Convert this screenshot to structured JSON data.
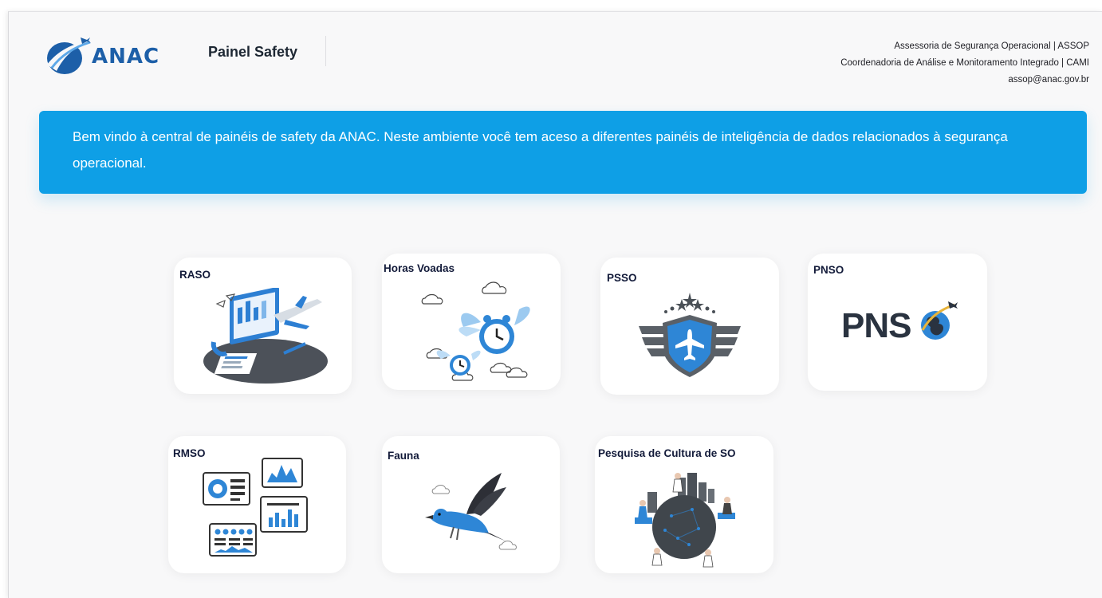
{
  "header": {
    "logo_text": "ANAC",
    "panel_title": "Painel Safety",
    "contact": {
      "line1": "Assessoria de Segurança Operacional | ASSOP",
      "line2": "Coordenadoria de Análise e Monitoramento Integrado | CAMI",
      "email": "assop@anac.gov.br"
    }
  },
  "banner": {
    "text": "Bem vindo à central de painéis de safety da ANAC. Neste ambiente você tem aceso a diferentes painéis de inteligência de dados relacionados à segurança operacional."
  },
  "cards": [
    {
      "title": "RASO"
    },
    {
      "title": "Horas Voadas"
    },
    {
      "title": "PSSO"
    },
    {
      "title": "PNSO",
      "logo_text": "PNS"
    },
    {
      "title": "RMSO"
    },
    {
      "title": "Fauna"
    },
    {
      "title": "Pesquisa de Cultura de SO"
    }
  ],
  "colors": {
    "brand_blue": "#1d5fa8",
    "banner_blue": "#0e9fe6",
    "card_title": "#131b3a",
    "illustration_blue": "#2e86d6"
  }
}
